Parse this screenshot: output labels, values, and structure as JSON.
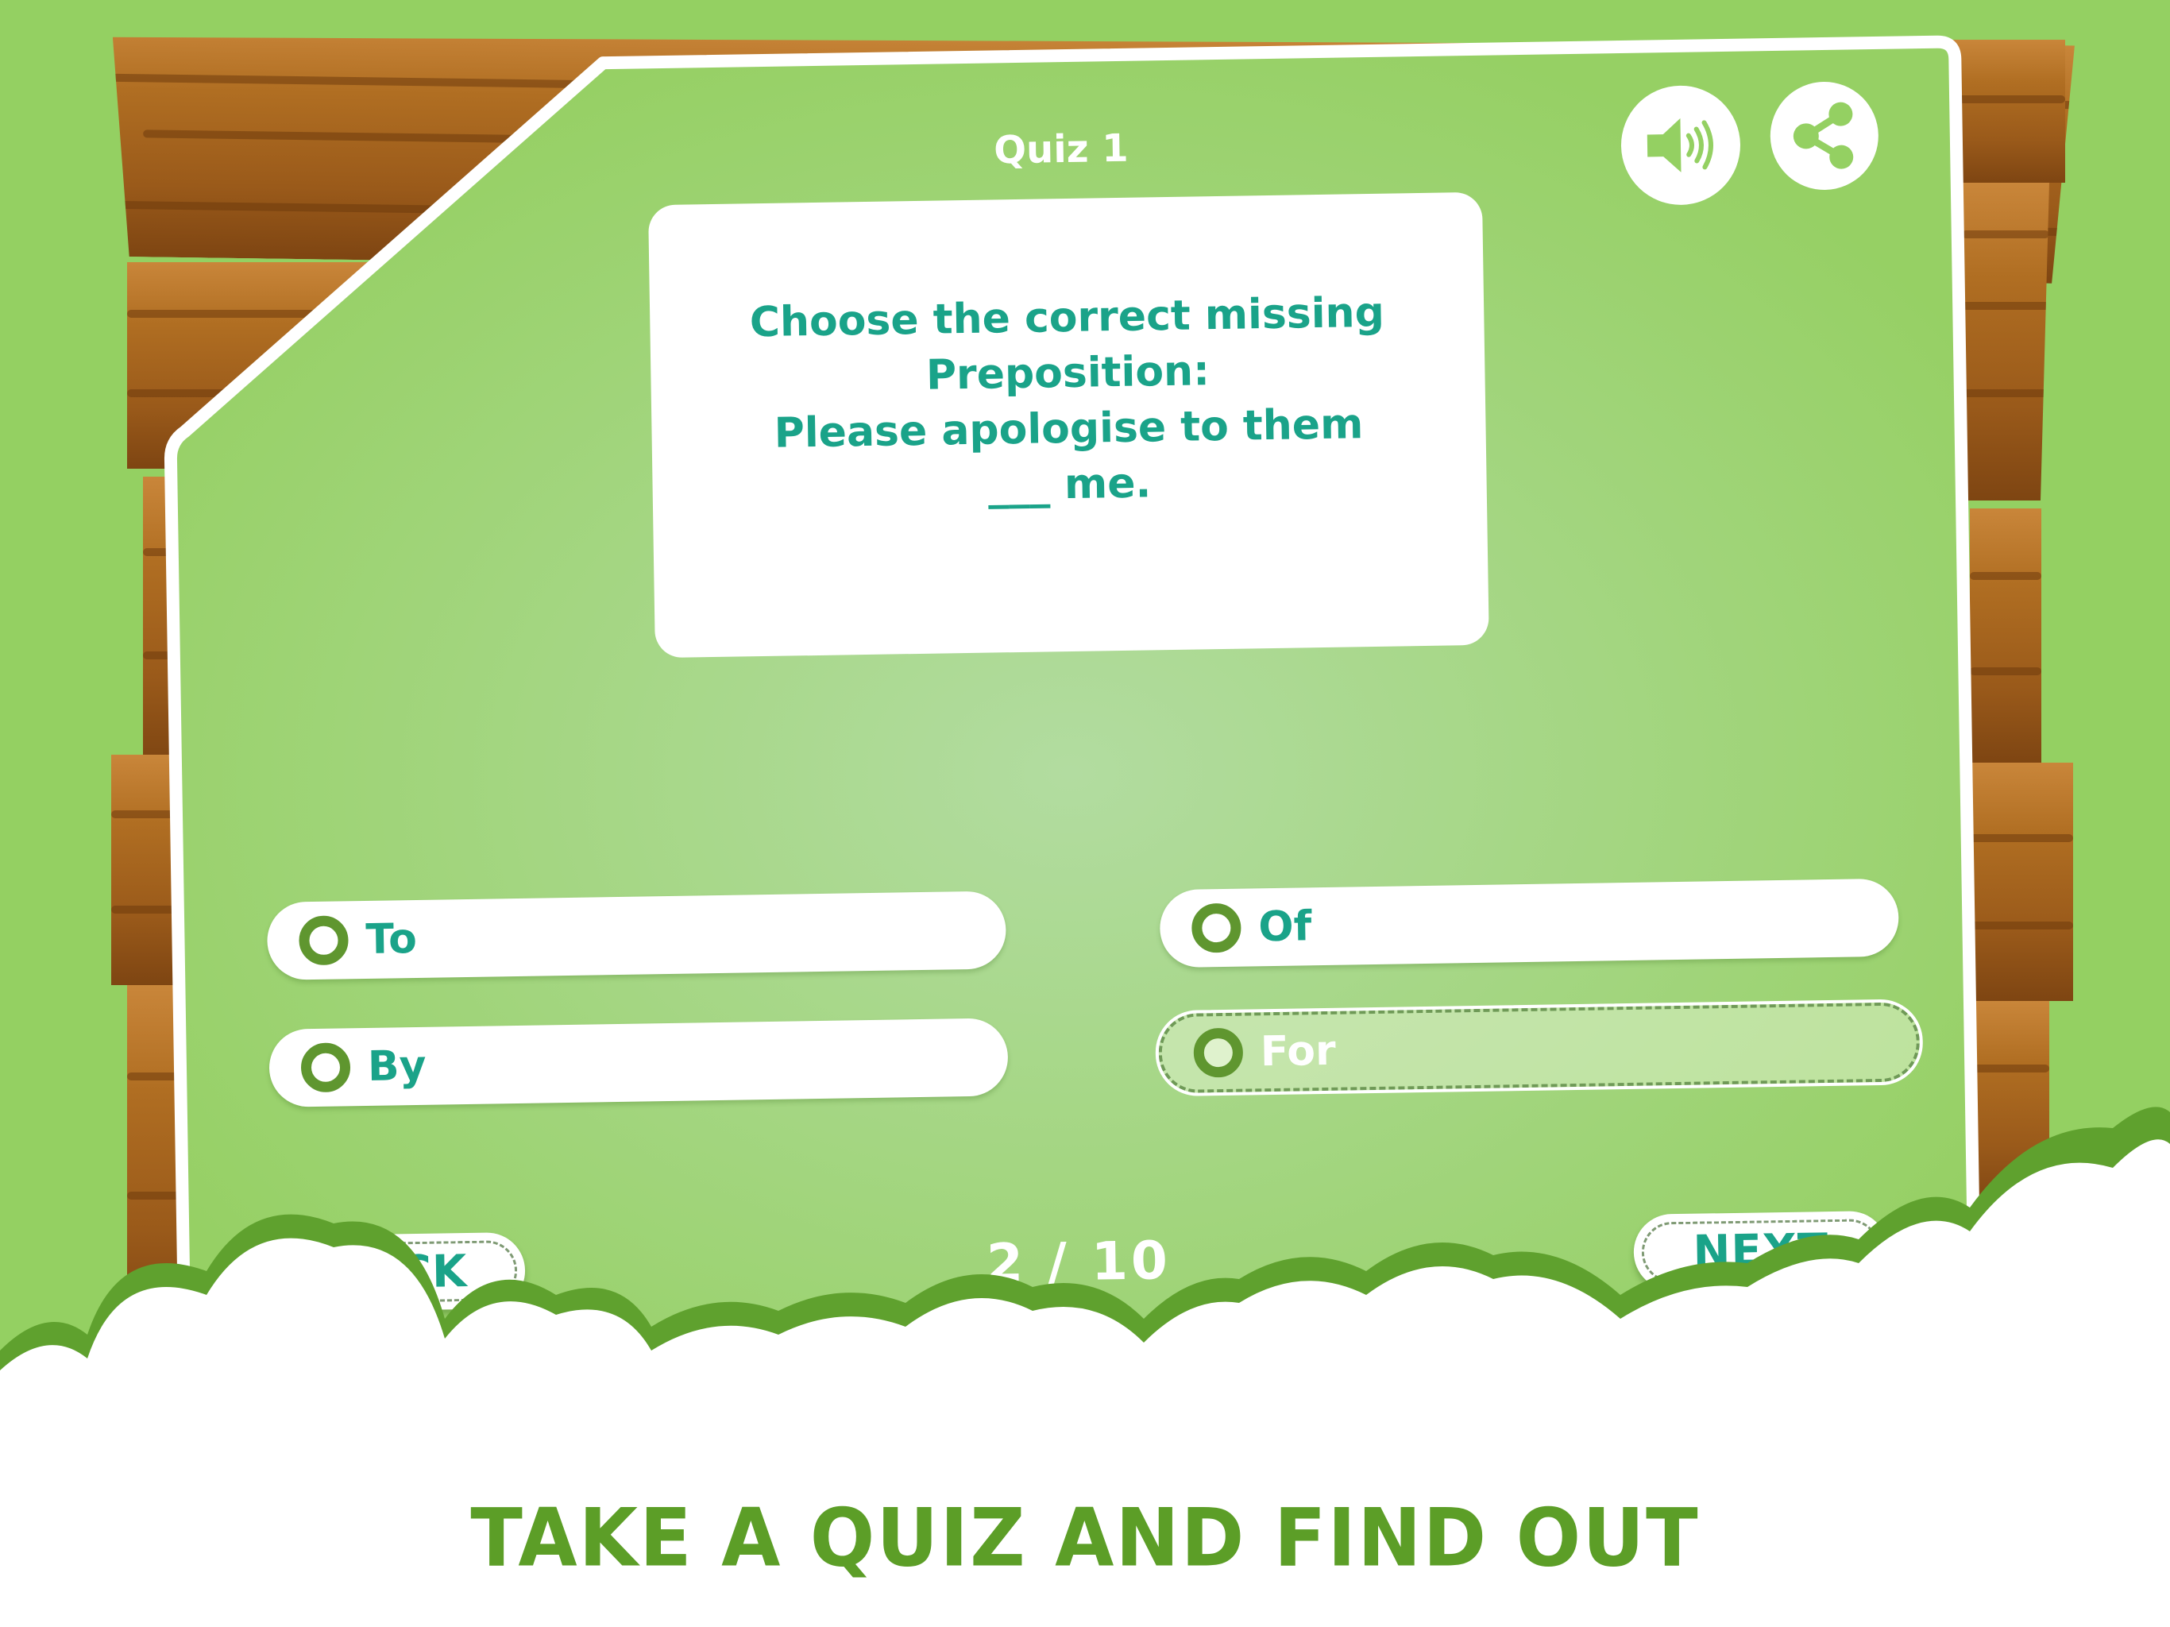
{
  "quiz": {
    "title": "Quiz 1",
    "question": "Choose the correct missing\nPreposition:\nPlease apologise to them\n___ me.",
    "options": [
      {
        "label": "To",
        "selected": false
      },
      {
        "label": "Of",
        "selected": false
      },
      {
        "label": "By",
        "selected": false
      },
      {
        "label": "For",
        "selected": true
      }
    ],
    "progress": {
      "current": 2,
      "total": 10,
      "text": "2 / 10"
    }
  },
  "toolbar": {
    "sound_icon": "speaker-volume-icon",
    "share_icon": "share-icon"
  },
  "navigation": {
    "back_label": "BACK",
    "next_label": "NEXT"
  },
  "footer": {
    "tagline": "TAKE A QUIZ AND FIND OUT"
  },
  "colors": {
    "background": "#94d062",
    "board": "#9dd372",
    "text_teal": "#1aa389",
    "radio_green": "#5f962f",
    "tagline_green": "#5c9e27",
    "wood": "#a86420"
  }
}
